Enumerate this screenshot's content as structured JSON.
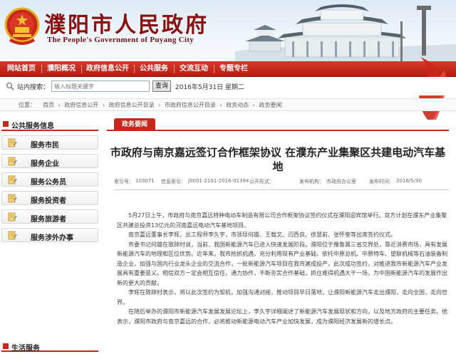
{
  "header": {
    "title": "濮阳市人民政府",
    "subtitle": "The People's Government of Puyang City"
  },
  "nav": {
    "items": [
      "网站首页",
      "濮阳概况",
      "政府信息公开",
      "公共服务",
      "交流互动",
      "专题专栏"
    ]
  },
  "search": {
    "label": "站内搜索：",
    "placeholder": "输入标题关键字",
    "button": "查询",
    "date": "2016年5月31日 星期二"
  },
  "breadcrumb": {
    "label": "位置：",
    "items": [
      "首页",
      "›",
      "政府信息公开",
      "›",
      "政府信息公开目录",
      "›",
      "市政府信息公开目录",
      "›",
      "政务动态",
      "›",
      "政务要闻"
    ]
  },
  "sidebar": {
    "heading": "公共服务信息",
    "items": [
      "服务市民",
      "服务企业",
      "服务公务员",
      "服务投资者",
      "服务旅游者",
      "服务涉外办事"
    ],
    "footer_heading": "生活服务"
  },
  "article": {
    "tab": "政务要闻",
    "title": "市政府与南京嘉远签订合作框架协议 在濮东产业集聚区共建电动汽车基地",
    "meta": {
      "index_label": "索引号：",
      "index": "103071",
      "code_label": "信息索引：",
      "code": "J0001-2101-2016-01394",
      "open_label": "公开形式：",
      "org_label": "发布机构：",
      "org": "市政府办公室",
      "date_label": "发布时间：",
      "date": "2016/5/30"
    },
    "paragraphs": [
      "5月27日上午，市政府与南京嘉远特种电动车制造有限公司合作框架协议签约仪式在濮阳迎宾馆举行。双方计划在濮东产业集聚区共建总投资13亿元的河南嘉远电动汽车基地项目。",
      "南京嘉远董事长李辉、总工程师李久宇，市领导何雄、王载文、闫西良、徐慧前、张怀奎等出席签约仪式。",
      "市委书记何雄在致辞时说，当前，我国新能源汽车已进入快速发展阶段。濮阳位于豫鲁冀三省交界处，靠近消费市场，具有发展新能源汽车的地理和区位优势。近年来，我市抢抓机遇，充分利用现有产业基础，依托中原总机、中原特车、望联机械等石油装备制造企业，加强与国内行业龙头企业的交流合作，一批新能源汽车项目在我市建成投产。此次成功签约，对推进我市新能源汽车产业发展具有重要意义。相信双方一定会相互信任，通力协作，不断夯实合作基础，抓住难得机遇大干一场，为中国新能源汽车的发展作出新的更大的贡献。",
      "李辉在致辞时表示，将以此次签约为契机，加强沟通对接，推动项目早日落地，让濮阳新能源汽车走出濮阳，走向全国，走向世界。",
      "在随后举办的濮阳市新能源汽车发展发展论坛上，李久宇详细阐述了新能源汽车发展现状和方向，以及地方政府的主要任务。他表示，濮阳市政府与南京嘉远的合作，必将推动新能源电动汽车产业加快发展，成为濮阳经济发展新的增长点。"
    ]
  },
  "colors": {
    "brand_red": "#c8281a",
    "title_red": "#8a1010"
  }
}
